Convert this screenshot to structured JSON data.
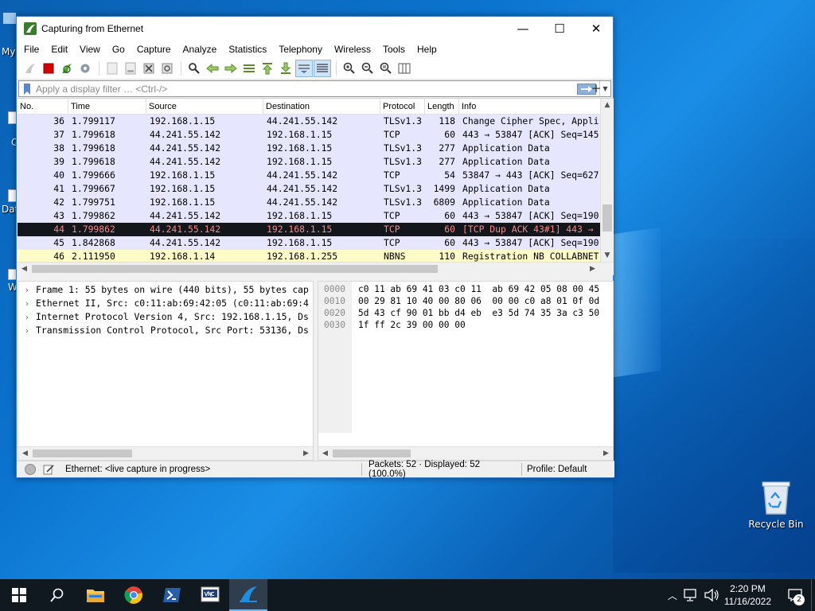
{
  "desktop": {
    "partial_labels": [
      "My",
      "C",
      "Dat",
      "W"
    ],
    "recycle_bin_label": "Recycle Bin"
  },
  "window": {
    "title": "Capturing from Ethernet",
    "controls": {
      "minimize": "—",
      "maximize": "☐",
      "close": "✕"
    }
  },
  "menu": [
    "File",
    "Edit",
    "View",
    "Go",
    "Capture",
    "Analyze",
    "Statistics",
    "Telephony",
    "Wireless",
    "Tools",
    "Help"
  ],
  "filter": {
    "placeholder": "Apply a display filter … <Ctrl-/>",
    "add_symbol": "+"
  },
  "packet_list": {
    "columns": [
      "No.",
      "Time",
      "Source",
      "Destination",
      "Protocol",
      "Length",
      "Info"
    ],
    "rows": [
      {
        "no": "36",
        "time": "1.799117",
        "src": "192.168.1.15",
        "dst": "44.241.55.142",
        "proto": "TLSv1.3",
        "len": "118",
        "info": "Change Cipher Spec, Appli",
        "style": "tcp"
      },
      {
        "no": "37",
        "time": "1.799618",
        "src": "44.241.55.142",
        "dst": "192.168.1.15",
        "proto": "TCP",
        "len": "60",
        "info": "443 → 53847 [ACK] Seq=145",
        "style": "tcp"
      },
      {
        "no": "38",
        "time": "1.799618",
        "src": "44.241.55.142",
        "dst": "192.168.1.15",
        "proto": "TLSv1.3",
        "len": "277",
        "info": "Application Data",
        "style": "tcp"
      },
      {
        "no": "39",
        "time": "1.799618",
        "src": "44.241.55.142",
        "dst": "192.168.1.15",
        "proto": "TLSv1.3",
        "len": "277",
        "info": "Application Data",
        "style": "tcp"
      },
      {
        "no": "40",
        "time": "1.799666",
        "src": "192.168.1.15",
        "dst": "44.241.55.142",
        "proto": "TCP",
        "len": "54",
        "info": "53847 → 443 [ACK] Seq=627",
        "style": "tcp"
      },
      {
        "no": "41",
        "time": "1.799667",
        "src": "192.168.1.15",
        "dst": "44.241.55.142",
        "proto": "TLSv1.3",
        "len": "1499",
        "info": "Application Data",
        "style": "tcp"
      },
      {
        "no": "42",
        "time": "1.799751",
        "src": "192.168.1.15",
        "dst": "44.241.55.142",
        "proto": "TLSv1.3",
        "len": "6809",
        "info": "Application Data",
        "style": "tcp"
      },
      {
        "no": "43",
        "time": "1.799862",
        "src": "44.241.55.142",
        "dst": "192.168.1.15",
        "proto": "TCP",
        "len": "60",
        "info": "443 → 53847 [ACK] Seq=190",
        "style": "tcp"
      },
      {
        "no": "44",
        "time": "1.799862",
        "src": "44.241.55.142",
        "dst": "192.168.1.15",
        "proto": "TCP",
        "len": "60",
        "info": "[TCP Dup ACK 43#1] 443 →",
        "style": "bad"
      },
      {
        "no": "45",
        "time": "1.842868",
        "src": "44.241.55.142",
        "dst": "192.168.1.15",
        "proto": "TCP",
        "len": "60",
        "info": "443 → 53847 [ACK] Seq=190",
        "style": "tcp"
      },
      {
        "no": "46",
        "time": "2.111950",
        "src": "192.168.1.14",
        "dst": "192.168.1.255",
        "proto": "NBNS",
        "len": "110",
        "info": "Registration NB COLLABNET",
        "style": "udp"
      }
    ]
  },
  "details": [
    "Frame 1: 55 bytes on wire (440 bits), 55 bytes cap",
    "Ethernet II, Src: c0:11:ab:69:42:05 (c0:11:ab:69:4",
    "Internet Protocol Version 4, Src: 192.168.1.15, Ds",
    "Transmission Control Protocol, Src Port: 53136, Ds"
  ],
  "bytes": [
    {
      "offset": "0000",
      "hex": "c0 11 ab 69 41 03 c0 11  ab 69 42 05 08 00 45"
    },
    {
      "offset": "0010",
      "hex": "00 29 81 10 40 00 80 06  00 00 c0 a8 01 0f 0d"
    },
    {
      "offset": "0020",
      "hex": "5d 43 cf 90 01 bb d4 eb  e3 5d 74 35 3a c3 50"
    },
    {
      "offset": "0030",
      "hex": "1f ff 2c 39 00 00 00"
    }
  ],
  "status": {
    "interface": "Ethernet: <live capture in progress>",
    "packets": "Packets: 52 · Displayed: 52 (100.0%)",
    "profile": "Profile: Default"
  },
  "taskbar": {
    "time": "2:20 PM",
    "date": "11/16/2022",
    "notification_count": "2"
  },
  "colors": {
    "row_tcp": "#e7e6ff",
    "row_udp": "#fdfcc9",
    "row_bad_bg": "#13171c",
    "row_bad_fg": "#f78787",
    "accent": "#0078d7"
  }
}
